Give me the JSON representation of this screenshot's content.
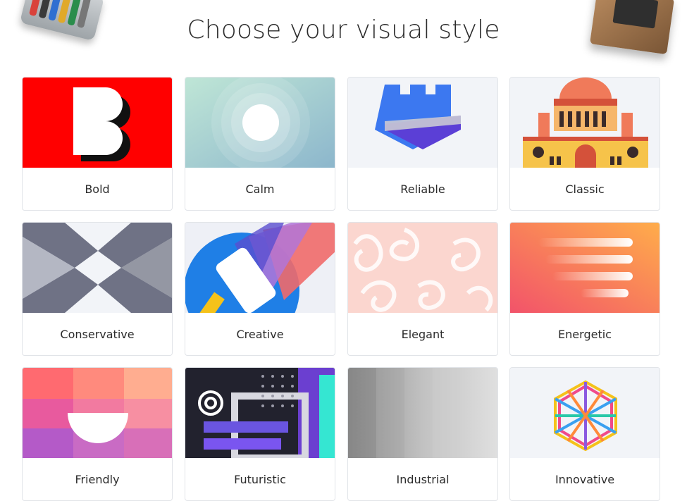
{
  "heading": "Choose your visual style",
  "styles": [
    {
      "label": "Bold"
    },
    {
      "label": "Calm"
    },
    {
      "label": "Reliable"
    },
    {
      "label": "Classic"
    },
    {
      "label": "Conservative"
    },
    {
      "label": "Creative"
    },
    {
      "label": "Elegant"
    },
    {
      "label": "Energetic"
    },
    {
      "label": "Friendly"
    },
    {
      "label": "Futuristic"
    },
    {
      "label": "Industrial"
    },
    {
      "label": "Innovative"
    }
  ],
  "colors": {
    "bold_red": "#ff0000",
    "reliable_blue": "#3c78f0",
    "reliable_purple": "#5b3fd6",
    "energetic_orange": "#ff8a4c",
    "card_border": "#e1e4e8"
  }
}
